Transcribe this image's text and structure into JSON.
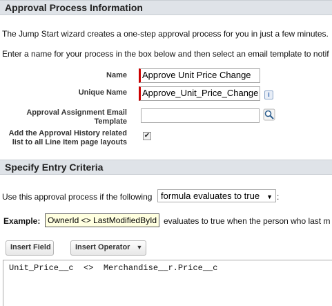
{
  "section1": {
    "title": "Approval Process Information",
    "intro": "The Jump Start wizard creates a one-step approval process for you in just a few minutes.",
    "instruction": "Enter a name for your process in the box below and then select an email template to notif"
  },
  "form": {
    "name_label": "Name",
    "name_value": "Approve Unit Price Change",
    "unique_name_label": "Unique Name",
    "unique_name_value": "Approve_Unit_Price_Change",
    "info_icon_text": "i",
    "email_template_label": "Approval Assignment Email Template",
    "email_template_value": "",
    "history_label": "Add the Approval History related list to all Line Item page layouts",
    "history_checked": "✔"
  },
  "section2": {
    "title": "Specify Entry Criteria",
    "use_text": "Use this approval process if the following",
    "criteria_select": "formula evaluates to true",
    "colon": ":",
    "example_label": "Example:",
    "example_formula": "OwnerId <> LastModifiedById",
    "example_text": "evaluates to true when the person who last m"
  },
  "buttons": {
    "insert_field": "Insert Field",
    "insert_operator": "Insert Operator",
    "dropdown_arrow": "▼"
  },
  "formula_text": "Unit_Price__c  <>  Merchandise__r.Price__c",
  "colors": {
    "header_bg": "#dfe3e8",
    "required_bar": "#cc0000",
    "example_bg": "#ffffe0"
  }
}
